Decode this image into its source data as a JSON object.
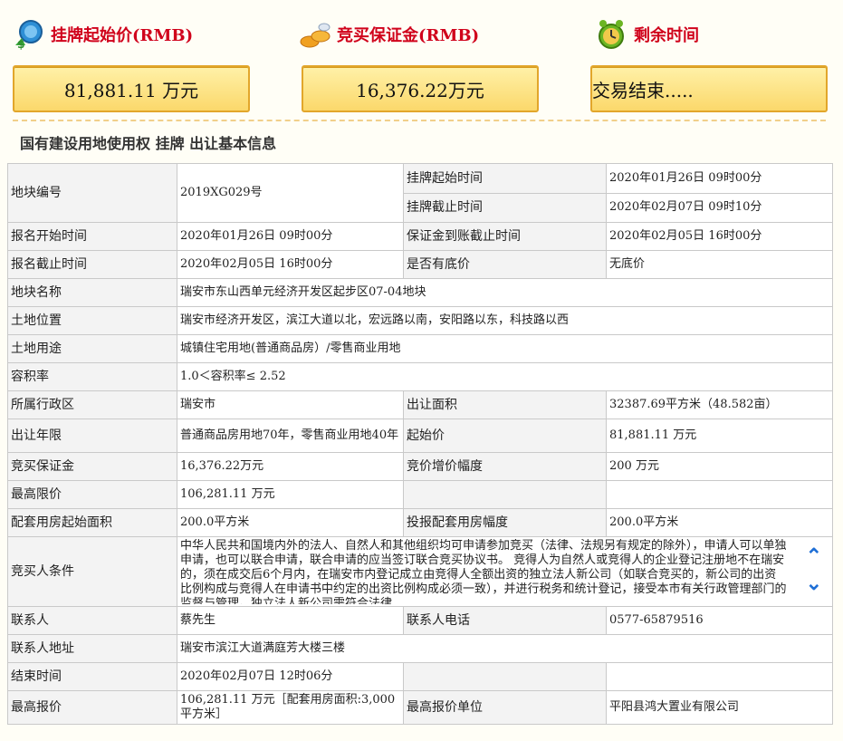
{
  "header": {
    "start_price_label": "挂牌起始价(RMB)",
    "deposit_label": "竞买保证金(RMB)",
    "remaining_label": "剩余时间",
    "start_price_value": "81,881.11 万元",
    "deposit_value": "16,376.22万元",
    "remaining_value": "交易结束....."
  },
  "section_title": "国有建设用地使用权 挂牌 出让基本信息",
  "rows": {
    "plot_no_k": "地块编号",
    "plot_no_v": "2019XG029号",
    "list_start_k": "挂牌起始时间",
    "list_start_v": "2020年01月26日 09时00分",
    "list_end_k": "挂牌截止时间",
    "list_end_v": "2020年02月07日 09时10分",
    "reg_start_k": "报名开始时间",
    "reg_start_v": "2020年01月26日 09时00分",
    "dep_deadline_k": "保证金到账截止时间",
    "dep_deadline_v": "2020年02月05日 16时00分",
    "reg_end_k": "报名截止时间",
    "reg_end_v": "2020年02月05日 16时00分",
    "reserve_k": "是否有底价",
    "reserve_v": "无底价",
    "name_k": "地块名称",
    "name_v": "瑞安市东山西单元经济开发区起步区07-04地块",
    "loc_k": "土地位置",
    "loc_v": "瑞安市经济开发区，滨江大道以北，宏远路以南，安阳路以东，科技路以西",
    "use_k": "土地用途",
    "use_v": "城镇住宅用地(普通商品房）/零售商业用地",
    "far_k": "容积率",
    "far_v": "1.0＜容积率≤ 2.52",
    "district_k": "所属行政区",
    "district_v": "瑞安市",
    "area_k": "出让面积",
    "area_v": "32387.69平方米（48.582亩）",
    "term_k": "出让年限",
    "term_v": "普通商品房用地70年，零售商业用地40年",
    "startprice_k": "起始价",
    "startprice_v": "81,881.11 万元",
    "deposit_k": "竞买保证金",
    "deposit_v": "16,376.22万元",
    "increment_k": "竞价增价幅度",
    "increment_v": "200 万元",
    "maxlimit_k": "最高限价",
    "maxlimit_v": "106,281.11 万元",
    "housing_start_k": "配套用房起始面积",
    "housing_start_v": "200.0平方米",
    "housing_inc_k": "投报配套用房幅度",
    "housing_inc_v": "200.0平方米",
    "cond_k": "竞买人条件",
    "cond_v": "中华人民共和国境内外的法人、自然人和其他组织均可申请参加竞买（法律、法规另有规定的除外），申请人可以单独申请，也可以联合申请，联合申请的应当签订联合竞买协议书。 竞得人为自然人或竞得人的企业登记注册地不在瑞安的，须在成交后6个月内，在瑞安市内登记成立由竞得人全额出资的独立法人新公司（如联合竞买的，新公司的出资比例构成与竞得人在申请书中约定的出资比例构成必须一致），并进行税务和统计登记，接受本市有关行政管理部门的监督与管理。独立法人新公司需符合法律",
    "contact_k": "联系人",
    "contact_v": "蔡先生",
    "phone_k": "联系人电话",
    "phone_v": "0577-65879516",
    "addr_k": "联系人地址",
    "addr_v": "瑞安市滨江大道满庭芳大楼三楼",
    "end_k": "结束时间",
    "end_v": "2020年02月07日 12时06分",
    "maxbid_k": "最高报价",
    "maxbid_v": "106,281.11 万元［配套用房面积:3,000平方米］",
    "maxbidder_k": "最高报价单位",
    "maxbidder_v": "平阳县鸿大置业有限公司"
  },
  "icons": {
    "price": "money-coin-icon",
    "deposit": "coins-icon",
    "time": "alarm-clock-icon",
    "scroll_up": "chevron-up-icon",
    "scroll_down": "chevron-down-icon"
  }
}
